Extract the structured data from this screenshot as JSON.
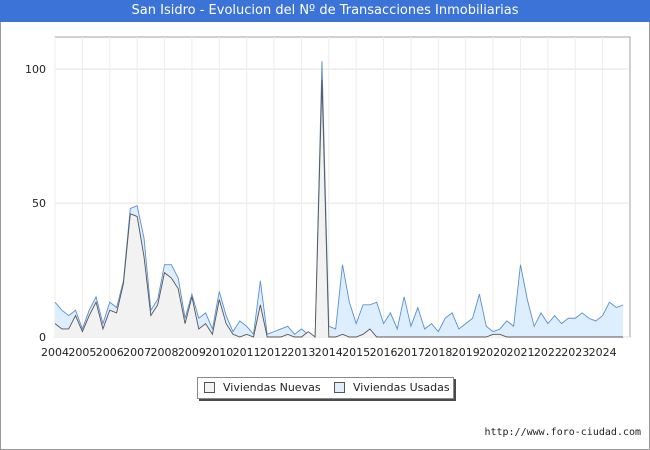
{
  "chart_data": {
    "type": "area",
    "title": "San Isidro - Evolucion del Nº de Transacciones Inmobiliarias",
    "xlabel": "",
    "ylabel": "",
    "x_ticks": [
      "2004",
      "2005",
      "2006",
      "2007",
      "2008",
      "2009",
      "2010",
      "2011",
      "2012",
      "2013",
      "2014",
      "2015",
      "2016",
      "2017",
      "2018",
      "2019",
      "2020",
      "2021",
      "2022",
      "2023",
      "2024"
    ],
    "y_ticks": [
      0,
      50,
      100
    ],
    "ylim": [
      0,
      112
    ],
    "xlim": [
      2004.0,
      2025.0
    ],
    "grid": true,
    "legend_position": "bottom",
    "x": [
      2004.0,
      2004.25,
      2004.5,
      2004.75,
      2005.0,
      2005.25,
      2005.5,
      2005.75,
      2006.0,
      2006.25,
      2006.5,
      2006.75,
      2007.0,
      2007.25,
      2007.5,
      2007.75,
      2008.0,
      2008.25,
      2008.5,
      2008.75,
      2009.0,
      2009.25,
      2009.5,
      2009.75,
      2010.0,
      2010.25,
      2010.5,
      2010.75,
      2011.0,
      2011.25,
      2011.5,
      2011.75,
      2012.0,
      2012.25,
      2012.5,
      2012.75,
      2013.0,
      2013.25,
      2013.5,
      2013.75,
      2014.0,
      2014.25,
      2014.5,
      2014.75,
      2015.0,
      2015.25,
      2015.5,
      2015.75,
      2016.0,
      2016.25,
      2016.5,
      2016.75,
      2017.0,
      2017.25,
      2017.5,
      2017.75,
      2018.0,
      2018.25,
      2018.5,
      2018.75,
      2019.0,
      2019.25,
      2019.5,
      2019.75,
      2020.0,
      2020.25,
      2020.5,
      2020.75,
      2021.0,
      2021.25,
      2021.5,
      2021.75,
      2022.0,
      2022.25,
      2022.5,
      2022.75,
      2023.0,
      2023.25,
      2023.5,
      2023.75,
      2024.0,
      2024.25,
      2024.5,
      2024.75
    ],
    "series": [
      {
        "name": "Viviendas Nuevas",
        "color": "#f2f2f2",
        "stroke": "#555555",
        "values": [
          5,
          3,
          3,
          8,
          2,
          8,
          13,
          3,
          10,
          9,
          20,
          46,
          45,
          30,
          8,
          12,
          24,
          22,
          18,
          5,
          15,
          3,
          5,
          1,
          14,
          5,
          1,
          0,
          1,
          0,
          12,
          0,
          0,
          0,
          1,
          0,
          0,
          2,
          0,
          96,
          0,
          0,
          1,
          0,
          0,
          1,
          3,
          0,
          0,
          0,
          0,
          0,
          0,
          0,
          0,
          0,
          0,
          0,
          0,
          0,
          0,
          0,
          0,
          0,
          1,
          1,
          0,
          0,
          0,
          0,
          0,
          0,
          0,
          0,
          0,
          0,
          0,
          0,
          0,
          0,
          0,
          0,
          0,
          0
        ]
      },
      {
        "name": "Viviendas Usadas",
        "color": "#ddeeff",
        "stroke": "#5a8fd0",
        "values": [
          13,
          10,
          8,
          10,
          3,
          10,
          15,
          5,
          13,
          11,
          21,
          48,
          49,
          37,
          10,
          14,
          27,
          27,
          22,
          7,
          16,
          7,
          9,
          3,
          17,
          8,
          2,
          6,
          4,
          1,
          21,
          1,
          2,
          3,
          4,
          1,
          3,
          1,
          0,
          103,
          4,
          3,
          27,
          13,
          5,
          12,
          12,
          13,
          5,
          9,
          3,
          15,
          4,
          11,
          3,
          5,
          2,
          7,
          9,
          3,
          5,
          7,
          16,
          4,
          2,
          3,
          6,
          4,
          27,
          14,
          4,
          9,
          5,
          8,
          5,
          7,
          7,
          9,
          7,
          6,
          8,
          13,
          11,
          12
        ]
      }
    ]
  },
  "legend": {
    "nuevas_label": "Viviendas Nuevas",
    "usadas_label": "Viviendas Usadas"
  },
  "source": "http://www.foro-ciudad.com"
}
